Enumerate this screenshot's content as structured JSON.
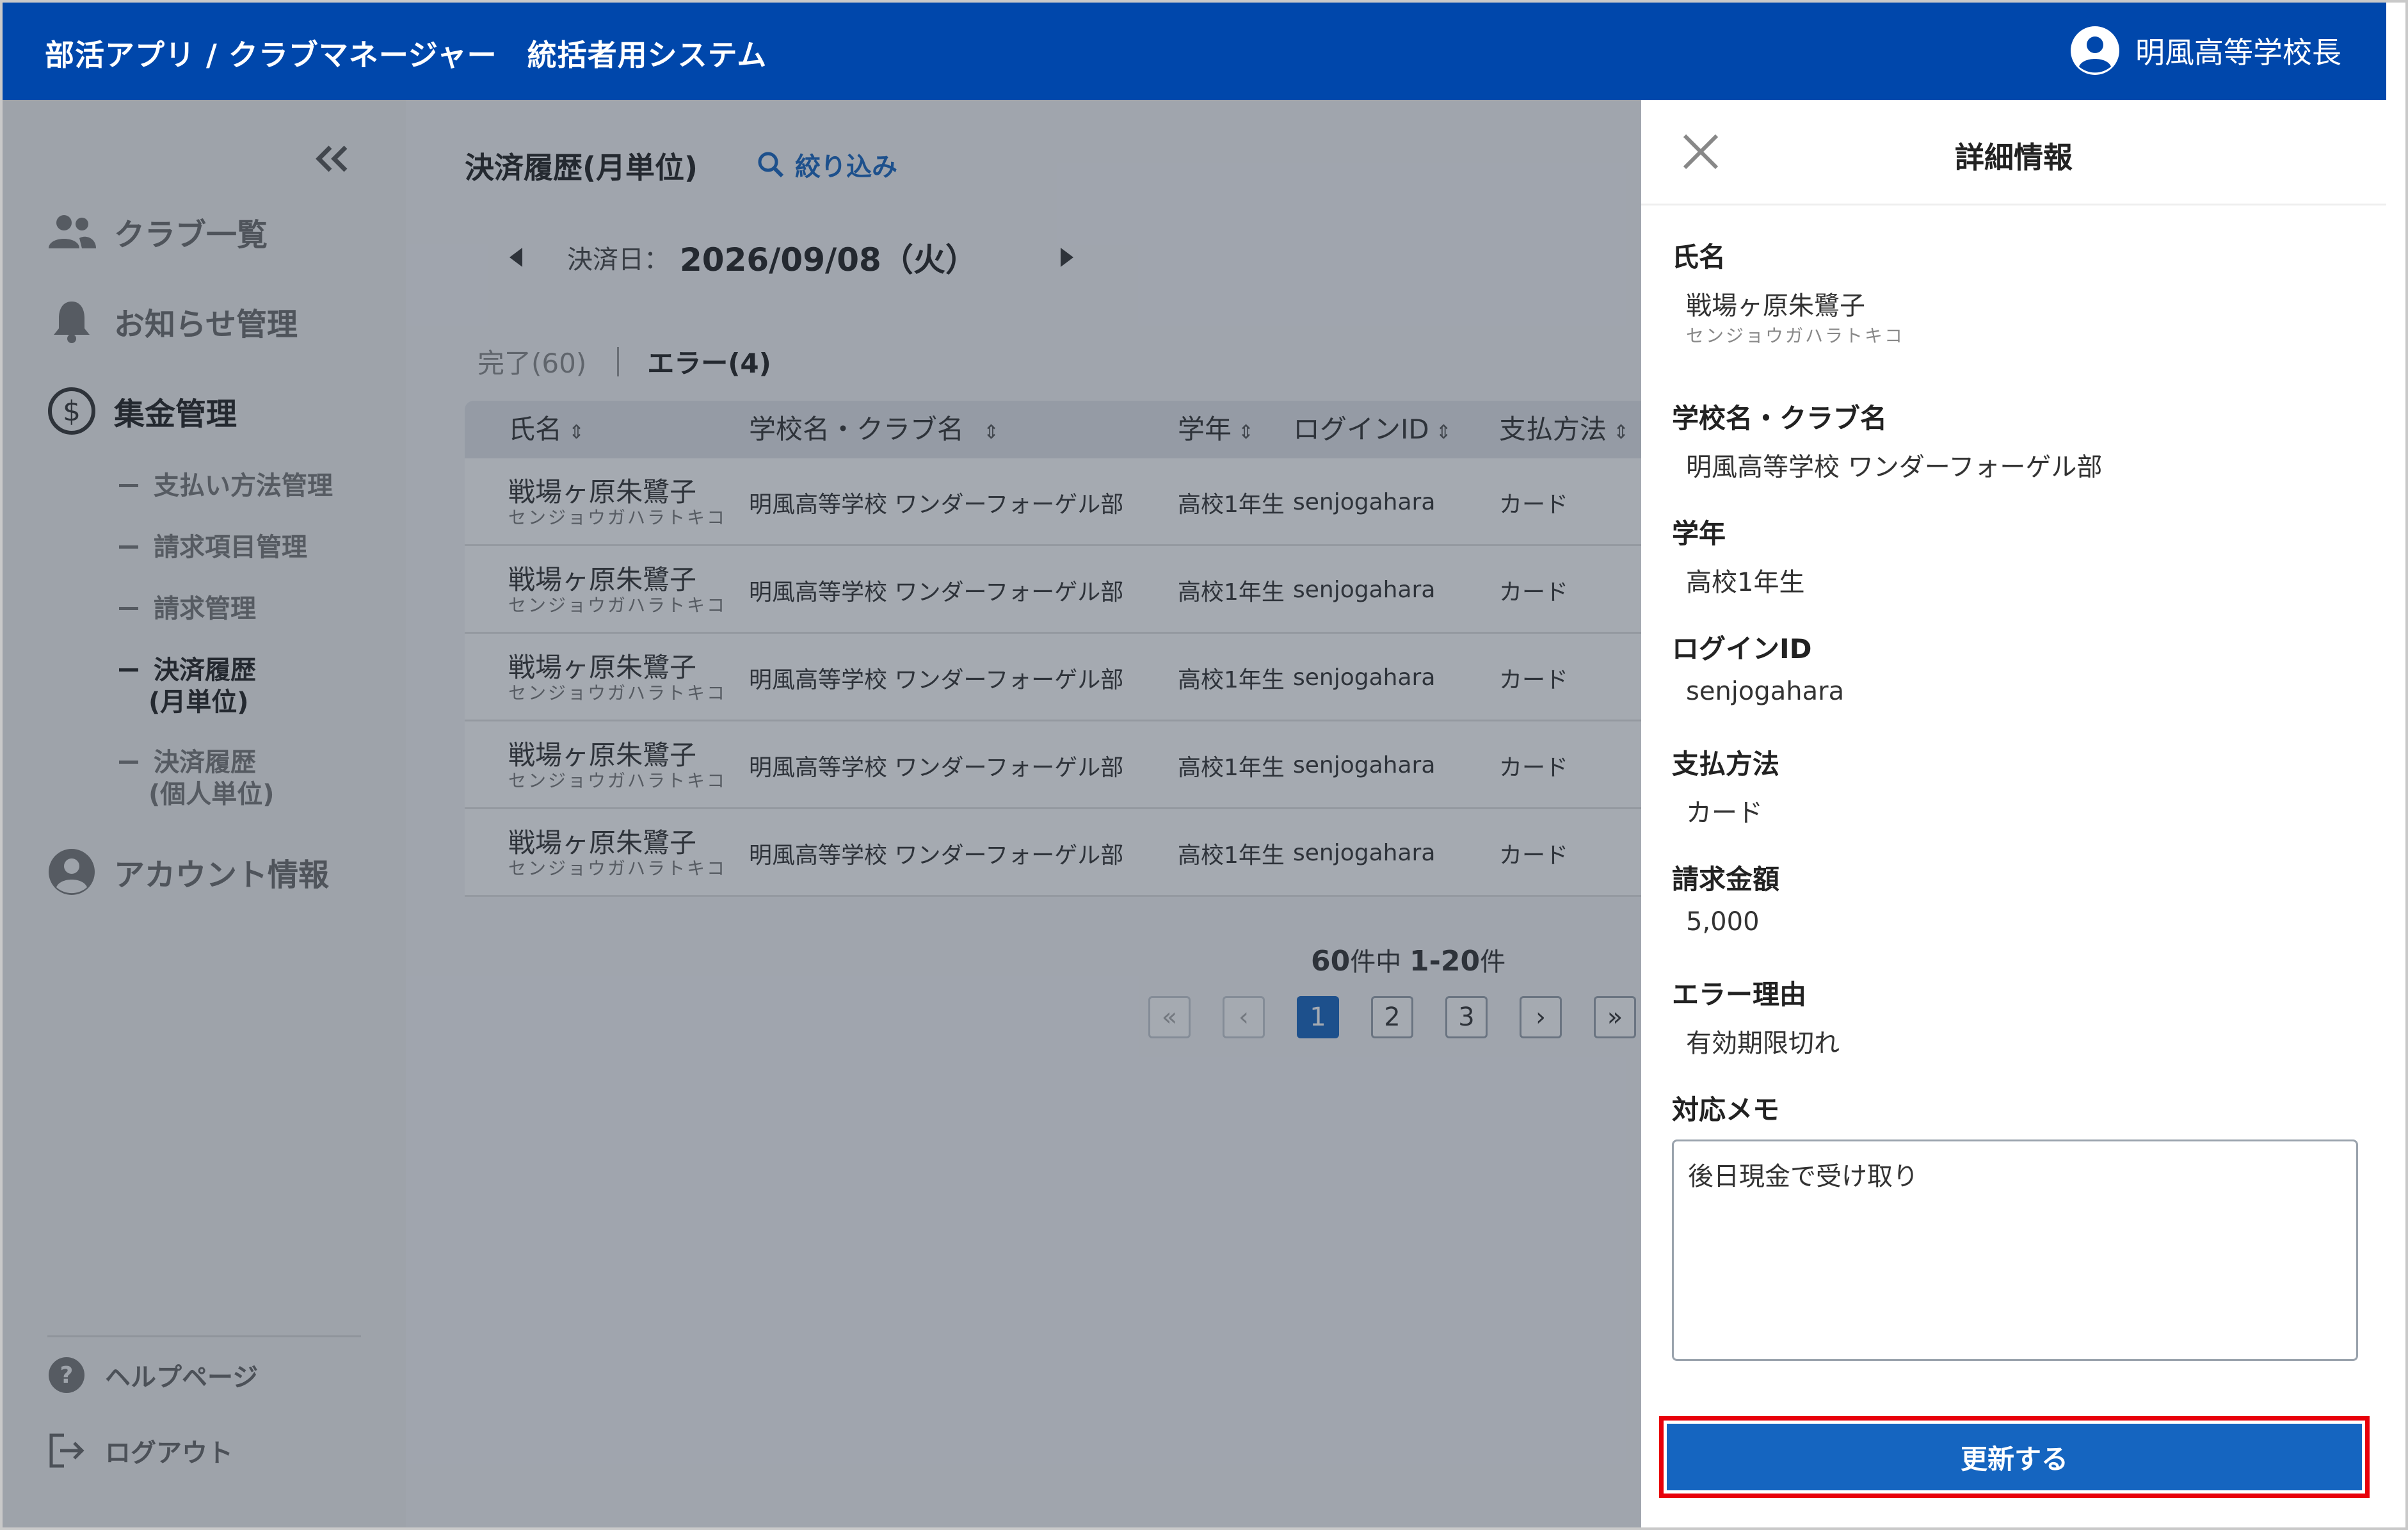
{
  "header": {
    "app_title": "部活アプリ / クラブマネージャー　統括者用システム",
    "user_name": "明風高等学校長"
  },
  "sidebar": {
    "items": [
      {
        "label": "クラブ一覧",
        "icon": "users-icon"
      },
      {
        "label": "お知らせ管理",
        "icon": "bell-icon"
      },
      {
        "label": "集金管理",
        "icon": "dollar-circle-icon"
      },
      {
        "label": "アカウント情報",
        "icon": "account-icon"
      }
    ],
    "sub_items": [
      {
        "label": "支払い方法管理",
        "cont": ""
      },
      {
        "label": "請求項目管理",
        "cont": ""
      },
      {
        "label": "請求管理",
        "cont": ""
      },
      {
        "label": "決済履歴",
        "cont": "(月単位)"
      },
      {
        "label": "決済履歴",
        "cont": "(個人単位)"
      }
    ],
    "footer": [
      {
        "label": "ヘルプページ",
        "icon": "help-icon"
      },
      {
        "label": "ログアウト",
        "icon": "logout-icon"
      }
    ]
  },
  "main": {
    "page_title": "決済履歴(月単位)",
    "filter_label": "絞り込み",
    "date_label": "決済日：",
    "date_value": "2026/09/08（火）",
    "tabs": [
      {
        "label": "完了(60)",
        "active": false
      },
      {
        "label": "エラー(4)",
        "active": true
      }
    ],
    "table": {
      "headers": [
        "氏名",
        "学校名・クラブ名",
        "学年",
        "ログインID",
        "支払方法"
      ],
      "sort_glyph": "⌃⌄",
      "rows": [
        {
          "name": "戦場ヶ原朱鷺子",
          "kana": "センジョウガハラトキコ",
          "school_club": "明風高等学校 ワンダーフォーゲル部",
          "grade": "高校1年生",
          "login_id": "senjogahara",
          "payment": "カード"
        },
        {
          "name": "戦場ヶ原朱鷺子",
          "kana": "センジョウガハラトキコ",
          "school_club": "明風高等学校 ワンダーフォーゲル部",
          "grade": "高校1年生",
          "login_id": "senjogahara",
          "payment": "カード"
        },
        {
          "name": "戦場ヶ原朱鷺子",
          "kana": "センジョウガハラトキコ",
          "school_club": "明風高等学校 ワンダーフォーゲル部",
          "grade": "高校1年生",
          "login_id": "senjogahara",
          "payment": "カード"
        },
        {
          "name": "戦場ヶ原朱鷺子",
          "kana": "センジョウガハラトキコ",
          "school_club": "明風高等学校 ワンダーフォーゲル部",
          "grade": "高校1年生",
          "login_id": "senjogahara",
          "payment": "カード"
        },
        {
          "name": "戦場ヶ原朱鷺子",
          "kana": "センジョウガハラトキコ",
          "school_club": "明風高等学校 ワンダーフォーゲル部",
          "grade": "高校1年生",
          "login_id": "senjogahara",
          "payment": "カード"
        }
      ]
    },
    "pagination": {
      "total": "60",
      "total_suffix": "件中",
      "range": "1-20",
      "range_suffix": "件",
      "first": "«",
      "prev": "‹",
      "pages": [
        "1",
        "2",
        "3"
      ],
      "current_page": "1",
      "next": "›",
      "last": "»"
    }
  },
  "detail": {
    "title": "詳細情報",
    "fields": [
      {
        "label": "氏名",
        "value": "戦場ヶ原朱鷺子",
        "sub": "センジョウガハラトキコ"
      },
      {
        "label": "学校名・クラブ名",
        "value": "明風高等学校 ワンダーフォーゲル部"
      },
      {
        "label": "学年",
        "value": "高校1年生"
      },
      {
        "label": "ログインID",
        "value": "senjogahara"
      },
      {
        "label": "支払方法",
        "value": "カード"
      },
      {
        "label": "請求金額",
        "value": "5,000"
      },
      {
        "label": "エラー理由",
        "value": "有効期限切れ"
      }
    ],
    "memo_label": "対応メモ",
    "memo_value": "後日現金で受け取り",
    "update_label": "更新する"
  },
  "colors": {
    "header": "#0047ab",
    "accent": "#1565c0",
    "highlight_border": "#e8000b"
  }
}
